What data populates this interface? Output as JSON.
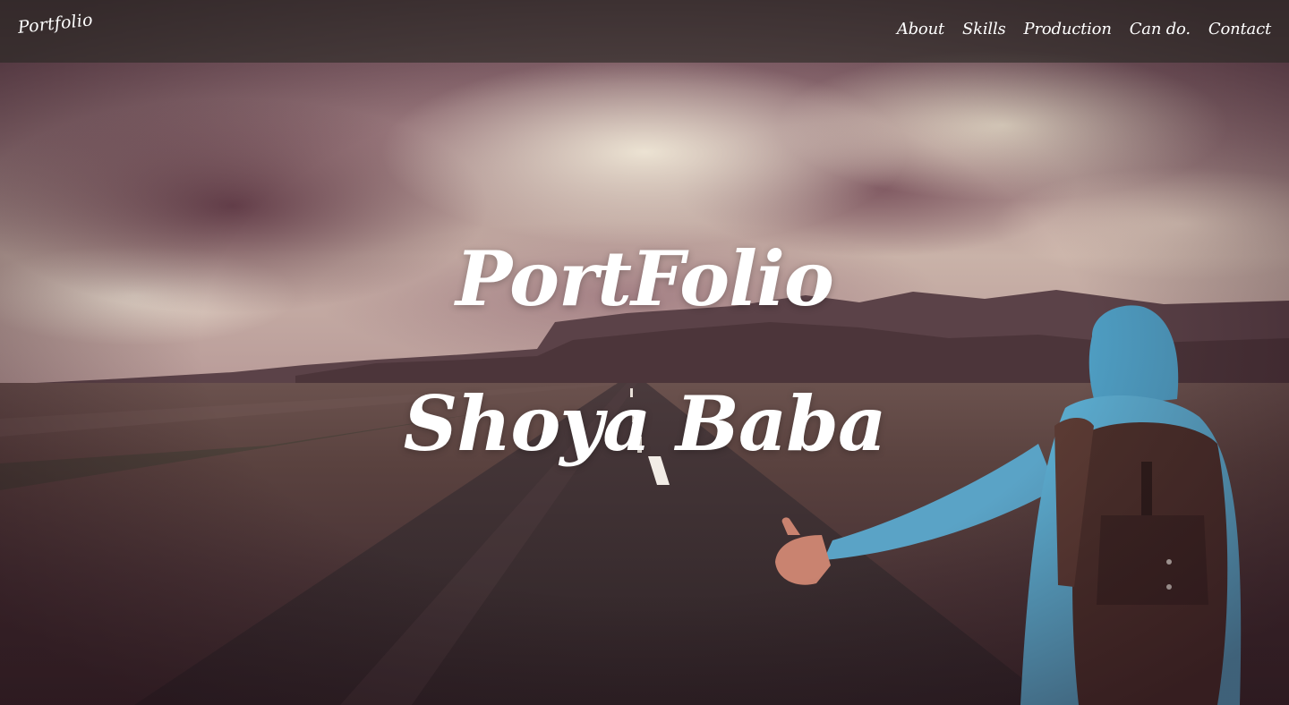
{
  "navbar": {
    "brand": "Portfolio",
    "links": [
      {
        "label": "About"
      },
      {
        "label": "Skills"
      },
      {
        "label": "Production"
      },
      {
        "label": "Can do."
      },
      {
        "label": "Contact"
      }
    ]
  },
  "hero": {
    "title": "PortFolio",
    "name": "Shoya Baba"
  },
  "colors": {
    "navbar_bg": "#28281f",
    "text": "#ffffff",
    "jacket": "#5fa8c9",
    "backpack": "#4a2f2a"
  }
}
